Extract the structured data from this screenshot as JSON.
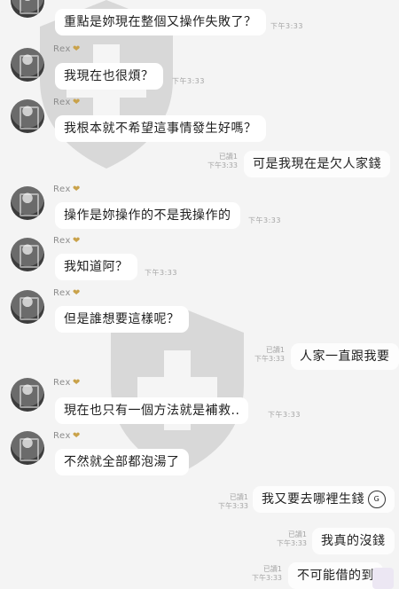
{
  "sender_name": "Rex",
  "sender_heart": "❤",
  "read_label": "已讀1",
  "time_label": "下午3:33",
  "messages": {
    "m1": "重點是妳現在整個又操作失敗了？",
    "m2": "我現在也很煩？",
    "m3": "我根本就不希望這事情發生好嗎？",
    "m4": "可是我現在是欠人家錢",
    "m5": "操作是妳操作的不是我操作的",
    "m6": "我知道阿？",
    "m7": "但是誰想要這樣呢？",
    "m8": "人家一直跟我要",
    "m9": "現在也只有一個方法就是補救..",
    "m10": "不然就全部都泡湯了",
    "m11": "我又要去哪裡生錢",
    "m12": "我真的沒錢",
    "m13": "不可能借的到"
  },
  "icons": {
    "avatar": "avatar-photo",
    "watermark": "shield-cross-watermark",
    "gif": "gif-badge-icon",
    "sticker": "sticker-icon"
  },
  "colors": {
    "background": "#f4f4f4",
    "bubble": "#ffffff"
  }
}
